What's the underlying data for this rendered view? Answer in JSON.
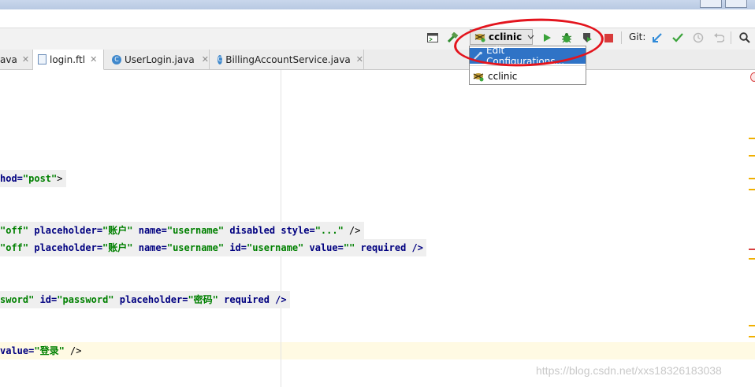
{
  "toolbar": {
    "run_config": "cclinic",
    "git_label": "Git:",
    "icons": [
      "terminal-icon",
      "build-hammer-icon",
      "run-config-icon",
      "chevron-down-icon",
      "run-icon",
      "debug-icon",
      "coverage-icon",
      "stop-icon",
      "git-update-icon",
      "git-commit-icon",
      "history-icon",
      "revert-icon",
      "search-icon"
    ]
  },
  "tabs": [
    {
      "label": "ava",
      "icon": "java-class-icon"
    },
    {
      "label": "login.ftl",
      "icon": "ftl-file-icon"
    },
    {
      "label": "UserLogin.java",
      "icon": "java-class-icon"
    },
    {
      "label": "BillingAccountService.java",
      "icon": "java-class-icon"
    }
  ],
  "dropdown": {
    "items": [
      {
        "label": "Edit Configurations..."
      },
      {
        "label": "cclinic"
      }
    ]
  },
  "code_lines": [
    {
      "parts": [
        "hod=",
        "\"post\"",
        ">"
      ]
    },
    {
      "parts": [
        "\"off\"",
        " placeholder=",
        "\"账户\"",
        " name=",
        "\"username\"",
        " disabled style=",
        "\"...\"",
        " />"
      ]
    },
    {
      "parts": [
        "\"off\"",
        " placeholder=",
        "\"账户\"",
        " name=",
        "\"username\"",
        " id=",
        "\"username\"",
        " value=",
        "\"\"",
        " required />"
      ]
    },
    {
      "parts": [
        "sword\"",
        " id=",
        "\"password\"",
        " placeholder=",
        "\"密码\"",
        " required />"
      ]
    },
    {
      "parts": [
        "value=",
        "\"登录\"",
        " />"
      ]
    }
  ],
  "watermark": "https://blog.csdn.net/xxs18326183038",
  "colors": {
    "accent": "#2f73c6",
    "annotation": "#e3141d",
    "keyword": "#000080",
    "string": "#008000"
  }
}
